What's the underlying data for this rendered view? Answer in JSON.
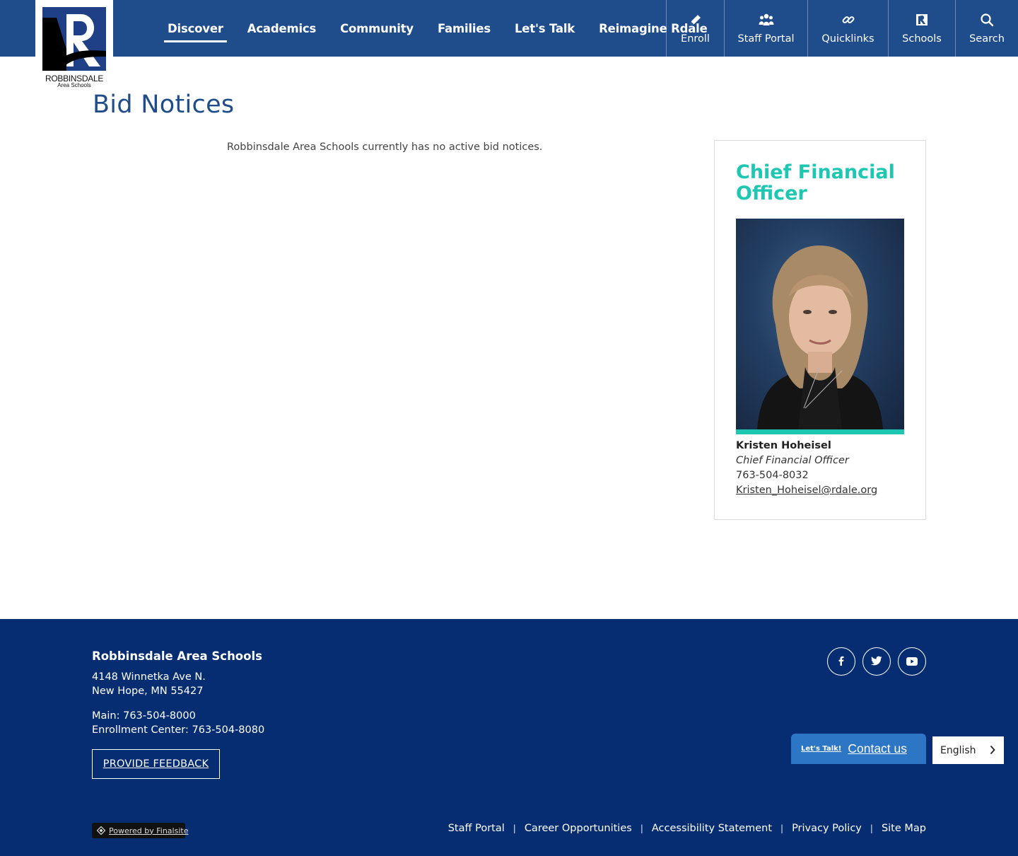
{
  "brand": {
    "logo_line1": "ROBBINSDALE",
    "logo_line2": "Area Schools"
  },
  "nav": {
    "items": [
      {
        "label": "Discover",
        "active": true
      },
      {
        "label": "Academics"
      },
      {
        "label": "Community"
      },
      {
        "label": "Families"
      },
      {
        "label": "Let's Talk"
      },
      {
        "label": "Reimagine Rdale"
      }
    ]
  },
  "utility": {
    "items": [
      {
        "label": "Enroll",
        "icon": "pencil-icon"
      },
      {
        "label": "Staff Portal",
        "icon": "people-icon"
      },
      {
        "label": "Quicklinks",
        "icon": "link-icon"
      },
      {
        "label": "Schools",
        "icon": "school-icon"
      },
      {
        "label": "Search",
        "icon": "search-icon"
      }
    ]
  },
  "page": {
    "title": "Bid Notices",
    "notice": "Robbinsdale Area Schools currently has no active bid notices."
  },
  "contact_card": {
    "title": "Chief Financial Officer",
    "name": "Kristen Hoheisel",
    "role": "Chief Financial Officer",
    "phone": "763-504-8032",
    "email": "Kristen_Hoheisel@rdale.org"
  },
  "footer": {
    "org_name": "Robbinsdale Area Schools",
    "address1": "4148 Winnetka Ave N.",
    "address2": "New Hope, MN 55427",
    "main_phone": "Main: 763-504-8000",
    "enroll_phone": "Enrollment Center: 763-504-8080",
    "feedback_button": "PROVIDE FEEDBACK",
    "social": [
      "facebook-icon",
      "twitter-icon",
      "youtube-icon"
    ],
    "contact_badge": "Let's Talk!",
    "contact_label": "Contact us",
    "language": "English",
    "powered_by": "Powered by Finalsite",
    "links": [
      "Staff Portal",
      "Career Opportunities",
      "Accessibility Statement",
      "Privacy Policy",
      "Site Map"
    ]
  },
  "colors": {
    "header_blue": "#1f4d8c",
    "footer_navy": "#062d72",
    "accent_teal": "#1ec7b2",
    "contact_blue": "#2d76c6"
  }
}
